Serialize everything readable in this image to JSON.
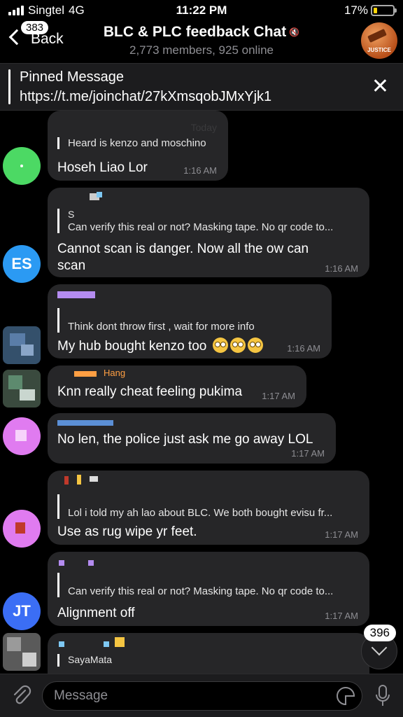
{
  "status_bar": {
    "carrier": "Singtel",
    "network": "4G",
    "time": "11:22 PM",
    "battery": "17%"
  },
  "header": {
    "back_badge": "383",
    "back_label": "Back",
    "title": "BLC & PLC feedback Chat",
    "subtitle": "2,773 members, 925 online",
    "avatar_text": "JUSTICE"
  },
  "pinned": {
    "title": "Pinned Message",
    "link": "https://t.me/joinchat/27kXmsqobJMxYjk1"
  },
  "messages": [
    {
      "sender": "",
      "reply_name": "",
      "reply_text": "Heard is kenzo and moschino",
      "text": "Hoseh Liao Lor",
      "time": "1:16 AM",
      "date_label": "Today"
    },
    {
      "sender": "",
      "reply_name": "S",
      "reply_text": "Can verify this real or not? Masking tape. No qr code to...",
      "text": "Cannot scan is danger. Now all the ow can scan",
      "time": "1:16 AM",
      "avatar": "ES"
    },
    {
      "sender": "",
      "reply_name": "",
      "reply_text": "Think dont throw first , wait for more info",
      "text": "My hub bought kenzo too",
      "time": "1:16 AM"
    },
    {
      "sender": "Hang",
      "text": "Knn really cheat feeling pukima",
      "time": "1:17 AM"
    },
    {
      "sender": "",
      "text": "No len, the police just ask me go away LOL",
      "time": "1:17 AM"
    },
    {
      "sender": "",
      "reply_name": "",
      "reply_text": "Lol i told my ah lao about BLC. We both bought evisu fr...",
      "text": "Use as rug wipe yr feet.",
      "time": "1:17 AM"
    },
    {
      "sender": "",
      "reply_name": "",
      "reply_text": "Can verify this real or not? Masking tape. No qr code to...",
      "text": "Alignment off",
      "time": "1:17 AM",
      "avatar": "JT"
    },
    {
      "sender": "",
      "reply_name": "SayaMata",
      "reply_text": ""
    }
  ],
  "scroll": {
    "unread": "396"
  },
  "input": {
    "placeholder": "Message"
  },
  "colors": {
    "bubble": "#262628",
    "accent_orange": "#ff9f43",
    "es_avatar": "#2b9af3",
    "jt_avatar": "#3b6ef5",
    "green_avatar": "#4cd964",
    "pink_avatar": "#e07bf0"
  }
}
